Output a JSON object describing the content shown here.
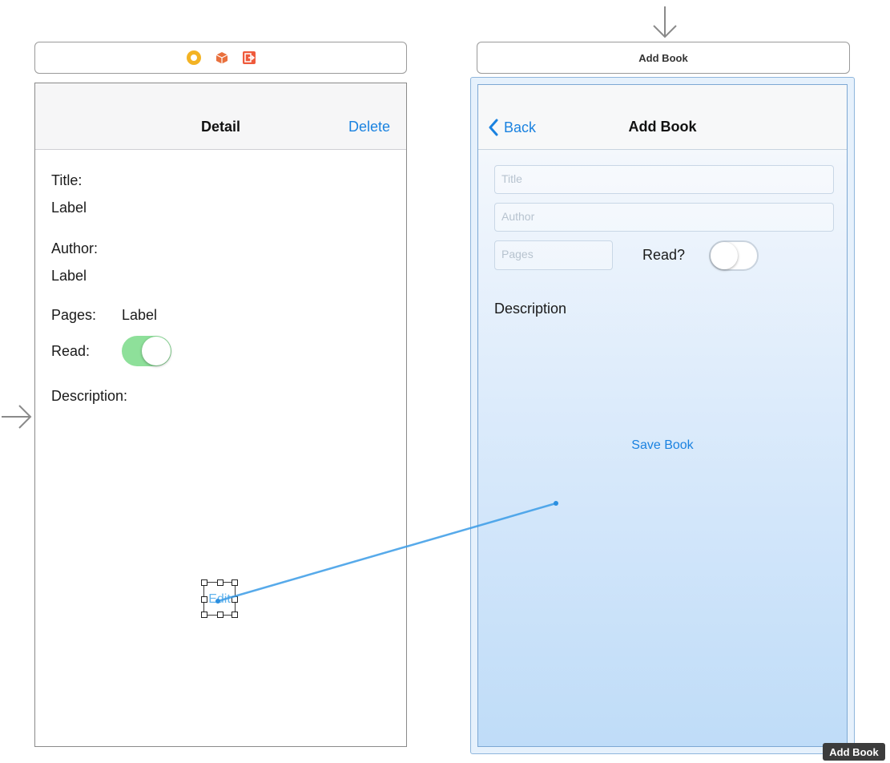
{
  "detail_scene": {
    "nav_title": "Detail",
    "nav_right_button": "Delete",
    "title_caption": "Title:",
    "title_value": "Label",
    "author_caption": "Author:",
    "author_value": "Label",
    "pages_caption": "Pages:",
    "pages_value": "Label",
    "read_caption": "Read:",
    "read_switch_on": true,
    "description_caption": "Description:",
    "edit_button": "Edit"
  },
  "add_book_scene": {
    "dock_title": "Add Book",
    "back_button": "Back",
    "nav_title": "Add Book",
    "title_placeholder": "Title",
    "author_placeholder": "Author",
    "pages_placeholder": "Pages",
    "read_caption": "Read?",
    "read_switch_on": false,
    "description_caption": "Description",
    "save_button": "Save Book"
  },
  "dock_icons": [
    "view-controller-icon",
    "first-responder-icon",
    "exit-icon"
  ],
  "tooltip": "Add Book",
  "colors": {
    "accent": "#1a82e0",
    "switch_on": "#8ee09a",
    "selection_blue": "#bfdcf8",
    "segue_line": "#3a9be6"
  }
}
